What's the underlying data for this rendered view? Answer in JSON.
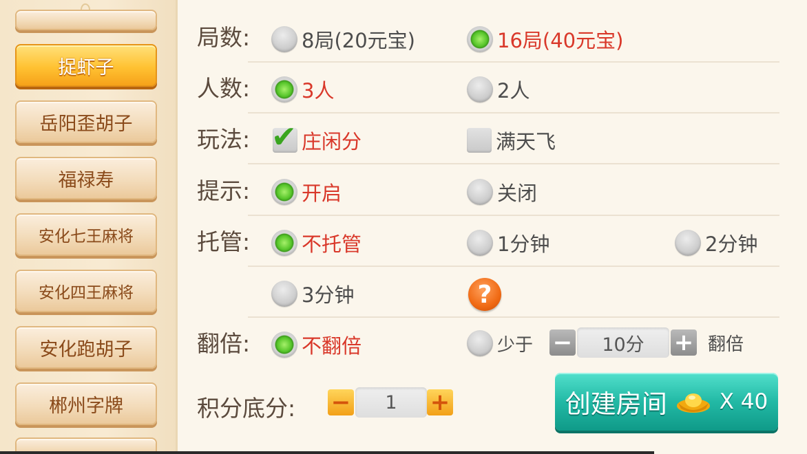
{
  "sidebar": {
    "items": [
      {
        "label": "捉虾子",
        "active": true
      },
      {
        "label": "岳阳歪胡子",
        "active": false
      },
      {
        "label": "福禄寿",
        "active": false
      },
      {
        "label": "安化七王麻将",
        "active": false
      },
      {
        "label": "安化四王麻将",
        "active": false
      },
      {
        "label": "安化跑胡子",
        "active": false
      },
      {
        "label": "郴州字牌",
        "active": false
      }
    ]
  },
  "options": {
    "rounds": {
      "label": "局数:",
      "choices": [
        {
          "text": "8局(20元宝)",
          "selected": false
        },
        {
          "text": "16局(40元宝)",
          "selected": true
        }
      ]
    },
    "players": {
      "label": "人数:",
      "choices": [
        {
          "text": "3人",
          "selected": true
        },
        {
          "text": "2人",
          "selected": false
        }
      ]
    },
    "gameplay": {
      "label": "玩法:",
      "choices": [
        {
          "text": "庄闲分",
          "checked": true
        },
        {
          "text": "满天飞",
          "checked": false
        }
      ]
    },
    "hint": {
      "label": "提示:",
      "choices": [
        {
          "text": "开启",
          "selected": true
        },
        {
          "text": "关闭",
          "selected": false
        }
      ]
    },
    "autoplay": {
      "label": "托管:",
      "choices": [
        {
          "text": "不托管",
          "selected": true
        },
        {
          "text": "1分钟",
          "selected": false
        },
        {
          "text": "2分钟",
          "selected": false
        },
        {
          "text": "3分钟",
          "selected": false
        }
      ],
      "help_icon": "?"
    },
    "double": {
      "label": "翻倍:",
      "choices": [
        {
          "text": "不翻倍",
          "selected": true
        },
        {
          "text": "少于",
          "selected": false
        }
      ],
      "threshold_value": "10分",
      "suffix": "翻倍",
      "minus": "−",
      "plus": "+"
    },
    "base_score": {
      "label": "积分底分:",
      "value": "1",
      "minus": "−",
      "plus": "+"
    }
  },
  "create_button": {
    "label": "创建房间",
    "cost": "X 40",
    "icon": "gold-ingot-icon"
  },
  "colors": {
    "selected_text": "#d9382a",
    "active_tab": "#f6a21a",
    "create_button": "#22b9a5"
  }
}
